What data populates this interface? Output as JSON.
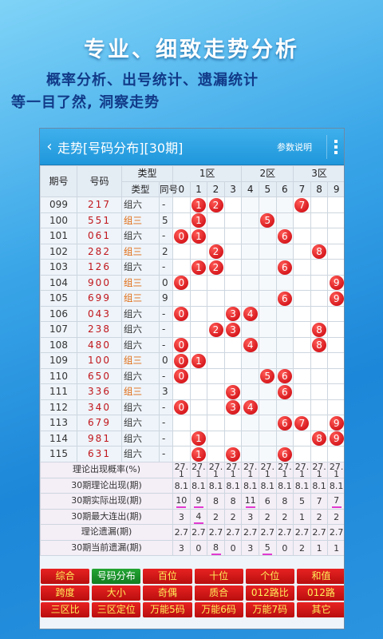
{
  "promo": {
    "headline": "专业、细致走势分析",
    "line1": "概率分析、出号统计、遗漏统计",
    "line2": "等一目了然, 洞察走势"
  },
  "appbar": {
    "back_icon": "chevron-left-icon",
    "title": "走势[号码分布][30期]",
    "help_label": "参数说明",
    "menu_icon": "overflow-menu-icon"
  },
  "table": {
    "headers": {
      "issue": "期号",
      "number": "号码",
      "type": "类型",
      "type_sub": "类型",
      "tong_sub": "同号",
      "zone1": "1区",
      "zone2": "2区",
      "zone3": "3区",
      "digits": [
        "0",
        "1",
        "2",
        "3",
        "4",
        "5",
        "6",
        "7",
        "8",
        "9"
      ]
    },
    "rows": [
      {
        "issue": "099",
        "number": "217",
        "type": "组六",
        "tong": "-",
        "balls": [
          1,
          2,
          7
        ]
      },
      {
        "issue": "100",
        "number": "551",
        "type": "组三",
        "tong": "5",
        "balls": [
          1,
          5
        ]
      },
      {
        "issue": "101",
        "number": "061",
        "type": "组六",
        "tong": "-",
        "balls": [
          0,
          1,
          6
        ]
      },
      {
        "issue": "102",
        "number": "282",
        "type": "组三",
        "tong": "2",
        "balls": [
          2,
          8
        ]
      },
      {
        "issue": "103",
        "number": "126",
        "type": "组六",
        "tong": "-",
        "balls": [
          1,
          2,
          6
        ]
      },
      {
        "issue": "104",
        "number": "900",
        "type": "组三",
        "tong": "0",
        "balls": [
          0,
          9
        ]
      },
      {
        "issue": "105",
        "number": "699",
        "type": "组三",
        "tong": "9",
        "balls": [
          6,
          9
        ]
      },
      {
        "issue": "106",
        "number": "043",
        "type": "组六",
        "tong": "-",
        "balls": [
          0,
          3,
          4
        ]
      },
      {
        "issue": "107",
        "number": "238",
        "type": "组六",
        "tong": "-",
        "balls": [
          2,
          3,
          8
        ]
      },
      {
        "issue": "108",
        "number": "480",
        "type": "组六",
        "tong": "-",
        "balls": [
          0,
          4,
          8
        ]
      },
      {
        "issue": "109",
        "number": "100",
        "type": "组三",
        "tong": "0",
        "balls": [
          0,
          1
        ]
      },
      {
        "issue": "110",
        "number": "650",
        "type": "组六",
        "tong": "-",
        "balls": [
          0,
          5,
          6
        ]
      },
      {
        "issue": "111",
        "number": "336",
        "type": "组三",
        "tong": "3",
        "balls": [
          3,
          6
        ]
      },
      {
        "issue": "112",
        "number": "340",
        "type": "组六",
        "tong": "-",
        "balls": [
          0,
          3,
          4
        ]
      },
      {
        "issue": "113",
        "number": "679",
        "type": "组六",
        "tong": "-",
        "balls": [
          6,
          7,
          9
        ]
      },
      {
        "issue": "114",
        "number": "981",
        "type": "组六",
        "tong": "-",
        "balls": [
          1,
          8,
          9
        ]
      },
      {
        "issue": "115",
        "number": "631",
        "type": "组六",
        "tong": "-",
        "balls": [
          1,
          3,
          6
        ]
      }
    ],
    "stats": [
      {
        "label": "理论出现概率(%)",
        "values": [
          "27.1",
          "27.1",
          "27.1",
          "27.1",
          "27.1",
          "27.1",
          "27.1",
          "27.1",
          "27.1",
          "27.1"
        ],
        "marks": [
          false,
          false,
          false,
          false,
          false,
          false,
          false,
          false,
          false,
          false
        ]
      },
      {
        "label": "30期理论出现(期)",
        "values": [
          "8.1",
          "8.1",
          "8.1",
          "8.1",
          "8.1",
          "8.1",
          "8.1",
          "8.1",
          "8.1",
          "8.1"
        ],
        "marks": [
          false,
          false,
          false,
          false,
          false,
          false,
          false,
          false,
          false,
          false
        ]
      },
      {
        "label": "30期实际出现(期)",
        "values": [
          "10",
          "9",
          "8",
          "8",
          "11",
          "6",
          "8",
          "5",
          "7",
          "7"
        ],
        "marks": [
          true,
          true,
          false,
          false,
          true,
          false,
          false,
          false,
          false,
          true
        ]
      },
      {
        "label": "30期最大连出(期)",
        "values": [
          "3",
          "4",
          "2",
          "2",
          "3",
          "2",
          "2",
          "1",
          "2",
          "2"
        ],
        "marks": [
          false,
          true,
          false,
          false,
          false,
          false,
          false,
          false,
          false,
          false
        ]
      },
      {
        "label": "理论遗漏(期)",
        "values": [
          "2.7",
          "2.7",
          "2.7",
          "2.7",
          "2.7",
          "2.7",
          "2.7",
          "2.7",
          "2.7",
          "2.7"
        ],
        "marks": [
          false,
          false,
          false,
          false,
          false,
          false,
          false,
          false,
          false,
          false
        ]
      },
      {
        "label": "30期当前遗漏(期)",
        "values": [
          "3",
          "0",
          "8",
          "0",
          "3",
          "5",
          "0",
          "2",
          "1",
          "1"
        ],
        "marks": [
          false,
          false,
          true,
          false,
          false,
          true,
          false,
          false,
          false,
          false
        ]
      }
    ]
  },
  "tabs": [
    [
      "综合",
      "号码分布",
      "百位",
      "十位",
      "个位",
      "和值"
    ],
    [
      "跨度",
      "大小",
      "奇偶",
      "质合",
      "012路比",
      "012路"
    ],
    [
      "三区比",
      "三区定位",
      "万能5码",
      "万能6码",
      "万能7码",
      "其它"
    ]
  ],
  "active_tab": "号码分布",
  "colors": {
    "ball": "#d81a1f",
    "number_text": "#c0161b",
    "type_san": "#e06a10",
    "tab_bg": "#d01818",
    "tab_text": "#ffef5a",
    "tab_active_bg": "#1a8e2a",
    "appbar": "#2aa2e2"
  }
}
